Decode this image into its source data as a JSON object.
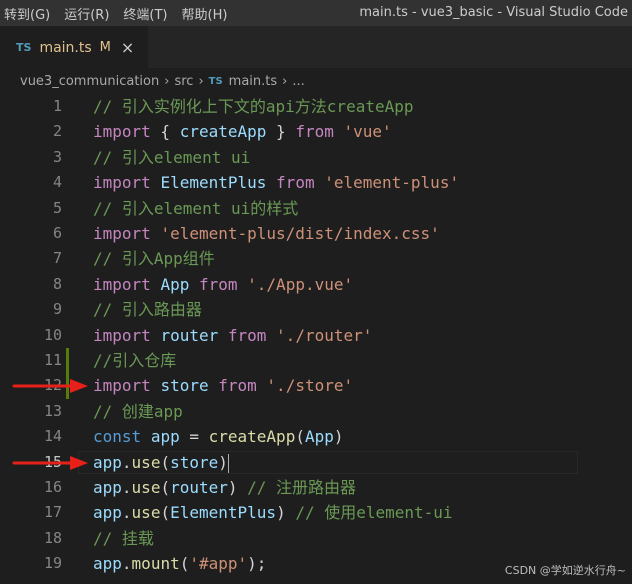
{
  "menu": [
    "转到(G)",
    "运行(R)",
    "终端(T)",
    "帮助(H)"
  ],
  "window_title": "main.ts - vue3_basic - Visual Studio Code",
  "tab": {
    "icon": "TS",
    "name": "main.ts",
    "modified": "M",
    "close": "×"
  },
  "breadcrumb": [
    "vue3_communication",
    "src",
    "main.ts",
    "..."
  ],
  "watermark": "CSDN @学如逆水行舟~",
  "lines": [
    {
      "n": "1",
      "tokens": [
        {
          "c": "cmt",
          "t": "// 引入实例化上下文的api方法createApp"
        }
      ]
    },
    {
      "n": "2",
      "tokens": [
        {
          "c": "kw2",
          "t": "import"
        },
        {
          "c": "plain",
          "t": " { "
        },
        {
          "c": "var",
          "t": "createApp"
        },
        {
          "c": "plain",
          "t": " } "
        },
        {
          "c": "kw2",
          "t": "from"
        },
        {
          "c": "plain",
          "t": " "
        },
        {
          "c": "str",
          "t": "'vue'"
        }
      ]
    },
    {
      "n": "3",
      "tokens": [
        {
          "c": "cmt",
          "t": "// 引入element ui"
        }
      ]
    },
    {
      "n": "4",
      "tokens": [
        {
          "c": "kw2",
          "t": "import"
        },
        {
          "c": "plain",
          "t": " "
        },
        {
          "c": "var",
          "t": "ElementPlus"
        },
        {
          "c": "plain",
          "t": " "
        },
        {
          "c": "kw2",
          "t": "from"
        },
        {
          "c": "plain",
          "t": " "
        },
        {
          "c": "str",
          "t": "'element-plus'"
        }
      ]
    },
    {
      "n": "5",
      "tokens": [
        {
          "c": "cmt",
          "t": "// 引入element ui的样式"
        }
      ]
    },
    {
      "n": "6",
      "tokens": [
        {
          "c": "kw2",
          "t": "import"
        },
        {
          "c": "plain",
          "t": " "
        },
        {
          "c": "str",
          "t": "'element-plus/dist/index.css'"
        }
      ]
    },
    {
      "n": "7",
      "tokens": [
        {
          "c": "cmt",
          "t": "// 引入App组件"
        }
      ]
    },
    {
      "n": "8",
      "tokens": [
        {
          "c": "kw2",
          "t": "import"
        },
        {
          "c": "plain",
          "t": " "
        },
        {
          "c": "var",
          "t": "App"
        },
        {
          "c": "plain",
          "t": " "
        },
        {
          "c": "kw2",
          "t": "from"
        },
        {
          "c": "plain",
          "t": " "
        },
        {
          "c": "str",
          "t": "'./App.vue'"
        }
      ]
    },
    {
      "n": "9",
      "tokens": [
        {
          "c": "cmt",
          "t": "// 引入路由器"
        }
      ]
    },
    {
      "n": "10",
      "tokens": [
        {
          "c": "kw2",
          "t": "import"
        },
        {
          "c": "plain",
          "t": " "
        },
        {
          "c": "var",
          "t": "router"
        },
        {
          "c": "plain",
          "t": " "
        },
        {
          "c": "kw2",
          "t": "from"
        },
        {
          "c": "plain",
          "t": " "
        },
        {
          "c": "str",
          "t": "'./router'"
        }
      ]
    },
    {
      "n": "11",
      "tokens": [
        {
          "c": "cmt",
          "t": "//引入仓库"
        }
      ]
    },
    {
      "n": "12",
      "tokens": [
        {
          "c": "kw2",
          "t": "import"
        },
        {
          "c": "plain",
          "t": " "
        },
        {
          "c": "var",
          "t": "store"
        },
        {
          "c": "plain",
          "t": " "
        },
        {
          "c": "kw2",
          "t": "from"
        },
        {
          "c": "plain",
          "t": " "
        },
        {
          "c": "str",
          "t": "'./store'"
        }
      ]
    },
    {
      "n": "13",
      "tokens": [
        {
          "c": "cmt",
          "t": "// 创建app"
        }
      ]
    },
    {
      "n": "14",
      "tokens": [
        {
          "c": "kw",
          "t": "const"
        },
        {
          "c": "plain",
          "t": " "
        },
        {
          "c": "var",
          "t": "app"
        },
        {
          "c": "plain",
          "t": " = "
        },
        {
          "c": "fn",
          "t": "createApp"
        },
        {
          "c": "plain",
          "t": "("
        },
        {
          "c": "var",
          "t": "App"
        },
        {
          "c": "plain",
          "t": ")"
        }
      ]
    },
    {
      "n": "15",
      "tokens": [
        {
          "c": "var",
          "t": "app"
        },
        {
          "c": "plain",
          "t": "."
        },
        {
          "c": "fn",
          "t": "use"
        },
        {
          "c": "plain",
          "t": "("
        },
        {
          "c": "var",
          "t": "store"
        },
        {
          "c": "plain",
          "t": ")"
        }
      ]
    },
    {
      "n": "16",
      "tokens": [
        {
          "c": "var",
          "t": "app"
        },
        {
          "c": "plain",
          "t": "."
        },
        {
          "c": "fn",
          "t": "use"
        },
        {
          "c": "plain",
          "t": "("
        },
        {
          "c": "var",
          "t": "router"
        },
        {
          "c": "plain",
          "t": ") "
        },
        {
          "c": "cmt",
          "t": "// 注册路由器"
        }
      ]
    },
    {
      "n": "17",
      "tokens": [
        {
          "c": "var",
          "t": "app"
        },
        {
          "c": "plain",
          "t": "."
        },
        {
          "c": "fn",
          "t": "use"
        },
        {
          "c": "plain",
          "t": "("
        },
        {
          "c": "var",
          "t": "ElementPlus"
        },
        {
          "c": "plain",
          "t": ") "
        },
        {
          "c": "cmt",
          "t": "// 使用element-ui"
        }
      ]
    },
    {
      "n": "18",
      "tokens": [
        {
          "c": "cmt",
          "t": "// 挂载"
        }
      ]
    },
    {
      "n": "19",
      "tokens": [
        {
          "c": "var",
          "t": "app"
        },
        {
          "c": "plain",
          "t": "."
        },
        {
          "c": "fn",
          "t": "mount"
        },
        {
          "c": "plain",
          "t": "("
        },
        {
          "c": "str",
          "t": "'#app'"
        },
        {
          "c": "plain",
          "t": ");"
        }
      ]
    }
  ],
  "active_line": "15",
  "arrow_lines": [
    "12",
    "15"
  ],
  "modified_lines": [
    "11",
    "12"
  ],
  "colors": {
    "arrow": "#e8201a",
    "modified_gutter": "#587c0c"
  }
}
